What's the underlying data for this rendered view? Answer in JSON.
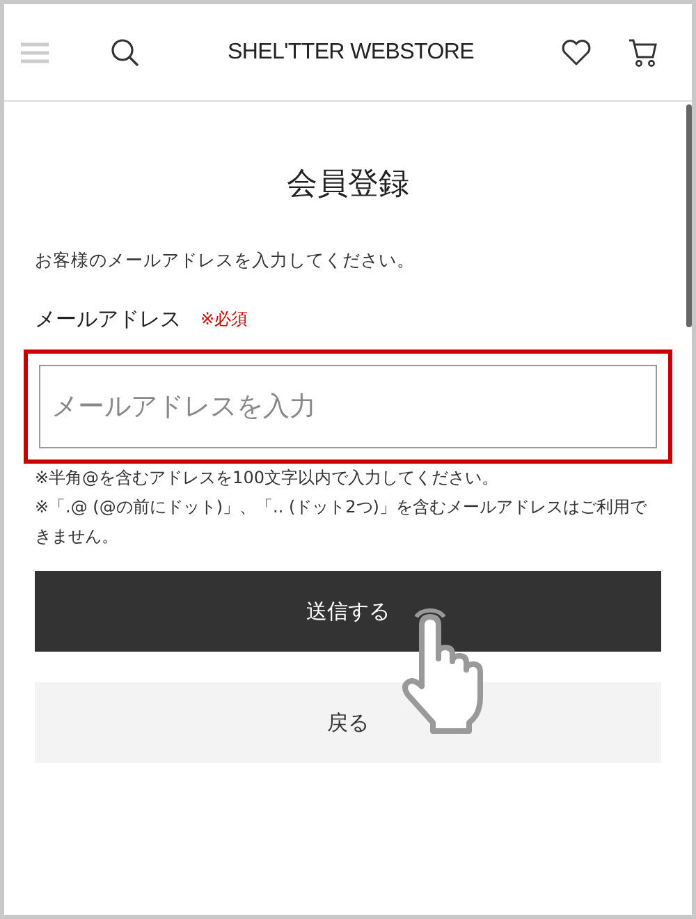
{
  "header": {
    "logo": "SHEL'TTER WEBSTORE"
  },
  "page_title": "会員登録",
  "intro": "お客様のメールアドレスを入力してください。",
  "field": {
    "label": "メールアドレス",
    "required": "※必須",
    "placeholder": "メールアドレスを入力",
    "highlighted": true
  },
  "notes": [
    "※半角@を含むアドレスを100文字以内で入力してください。",
    "※「.@ (@の前にドット)」、「.. (ドット2つ)」を含むメールアドレスはご利用できません。"
  ],
  "buttons": [
    {
      "label": "送信する",
      "kind": "primary"
    },
    {
      "label": "戻る",
      "kind": "secondary"
    }
  ]
}
